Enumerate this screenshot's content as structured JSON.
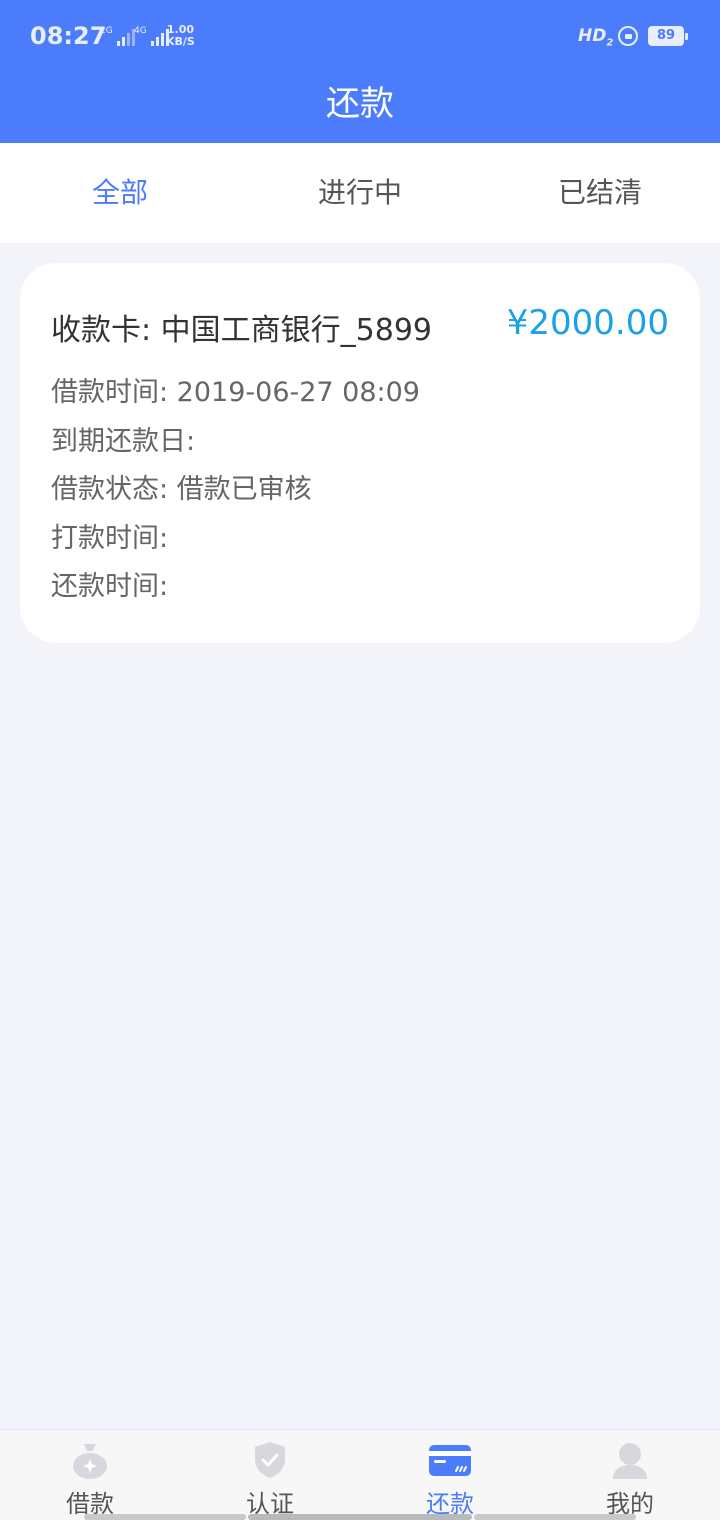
{
  "status_bar": {
    "time": "08:27",
    "sim1": "2G",
    "sim2": "4G",
    "speed_value": "1.00",
    "speed_unit": "KB/S",
    "hd": "HD",
    "hd_sub": "2",
    "battery": "89"
  },
  "header": {
    "title": "还款"
  },
  "tabs": [
    {
      "label": "全部",
      "active": true
    },
    {
      "label": "进行中",
      "active": false
    },
    {
      "label": "已结清",
      "active": false
    }
  ],
  "loan_card": {
    "title": "收款卡: 中国工商银行_5899",
    "amount": "¥2000.00",
    "rows": [
      "借款时间: 2019-06-27 08:09",
      "到期还款日:",
      "借款状态: 借款已审核",
      "打款时间:",
      "还款时间:"
    ]
  },
  "tabbar": {
    "items": [
      {
        "label": "借款",
        "icon": "money-bag-icon",
        "active": false
      },
      {
        "label": "认证",
        "icon": "shield-check-icon",
        "active": false
      },
      {
        "label": "还款",
        "icon": "card-icon",
        "active": true
      },
      {
        "label": "我的",
        "icon": "user-icon",
        "active": false
      }
    ]
  },
  "colors": {
    "primary": "#4b7cfb",
    "amount": "#1aa1e8",
    "background": "#f2f4f9",
    "icon_inactive": "#d6d8de"
  }
}
